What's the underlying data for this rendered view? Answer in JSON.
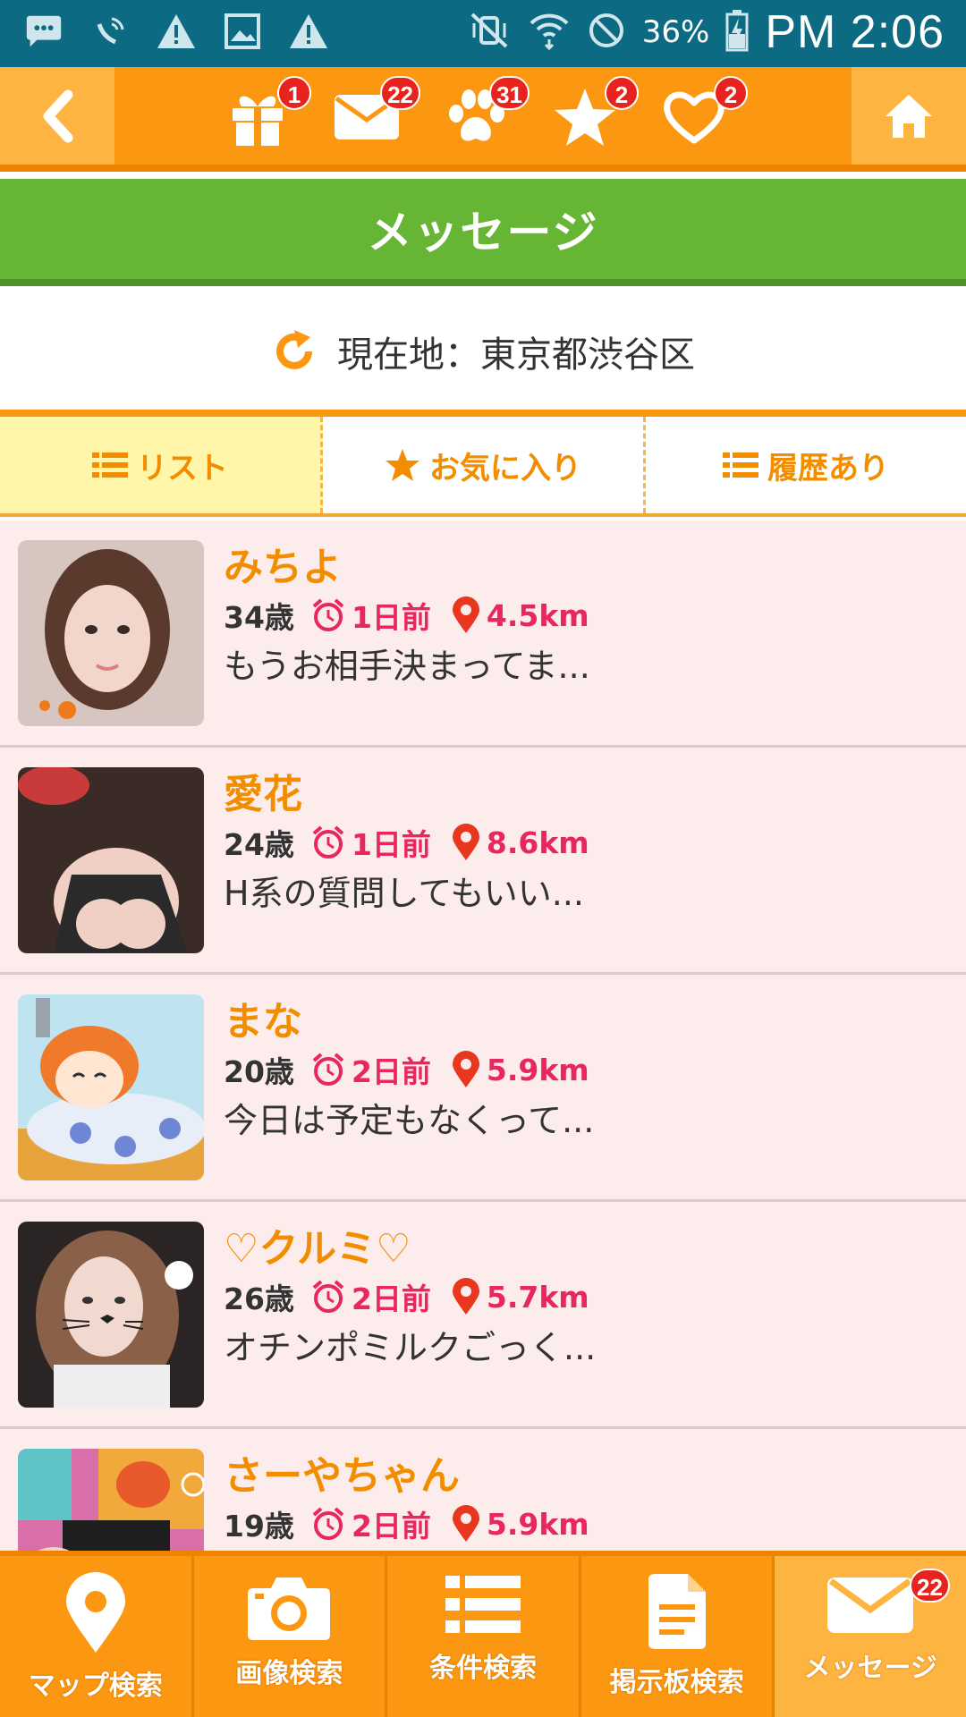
{
  "status_bar": {
    "battery": "36%",
    "time": "PM 2:06"
  },
  "top_nav": {
    "badges": {
      "gift": "1",
      "mail": "22",
      "footprint": "31",
      "star": "2",
      "heart": "2"
    }
  },
  "title": "メッセージ",
  "location": {
    "text": "現在地：東京都渋谷区"
  },
  "tabs": [
    {
      "label": "リスト",
      "active": true
    },
    {
      "label": "お気に入り",
      "active": false
    },
    {
      "label": "履歴あり",
      "active": false
    }
  ],
  "messages": [
    {
      "name": "みちよ",
      "age": "34歳",
      "time": "1日前",
      "distance": "4.5km",
      "preview": "もうお相手決まってま..."
    },
    {
      "name": "愛花",
      "age": "24歳",
      "time": "1日前",
      "distance": "8.6km",
      "preview": "H系の質問してもいい..."
    },
    {
      "name": "まな",
      "age": "20歳",
      "time": "2日前",
      "distance": "5.9km",
      "preview": "今日は予定もなくって..."
    },
    {
      "name": "♡クルミ♡",
      "age": "26歳",
      "time": "2日前",
      "distance": "5.7km",
      "preview": "オチンポミルクごっく..."
    },
    {
      "name": "さーやちゃん",
      "age": "19歳",
      "time": "2日前",
      "distance": "5.9km",
      "preview": ""
    }
  ],
  "bottom_nav": [
    {
      "label": "マップ検索",
      "icon": "map-pin-icon"
    },
    {
      "label": "画像検索",
      "icon": "camera-icon"
    },
    {
      "label": "条件検索",
      "icon": "list-icon"
    },
    {
      "label": "掲示板検索",
      "icon": "document-icon"
    },
    {
      "label": "メッセージ",
      "icon": "mail-icon",
      "badge": "22"
    }
  ],
  "colors": {
    "accent_orange": "#fb9710",
    "title_green": "#67b534",
    "status_teal": "#0c6b82",
    "name_orange": "#f28d00",
    "meta_pink": "#e8275c",
    "row_bg": "#fdecec"
  }
}
